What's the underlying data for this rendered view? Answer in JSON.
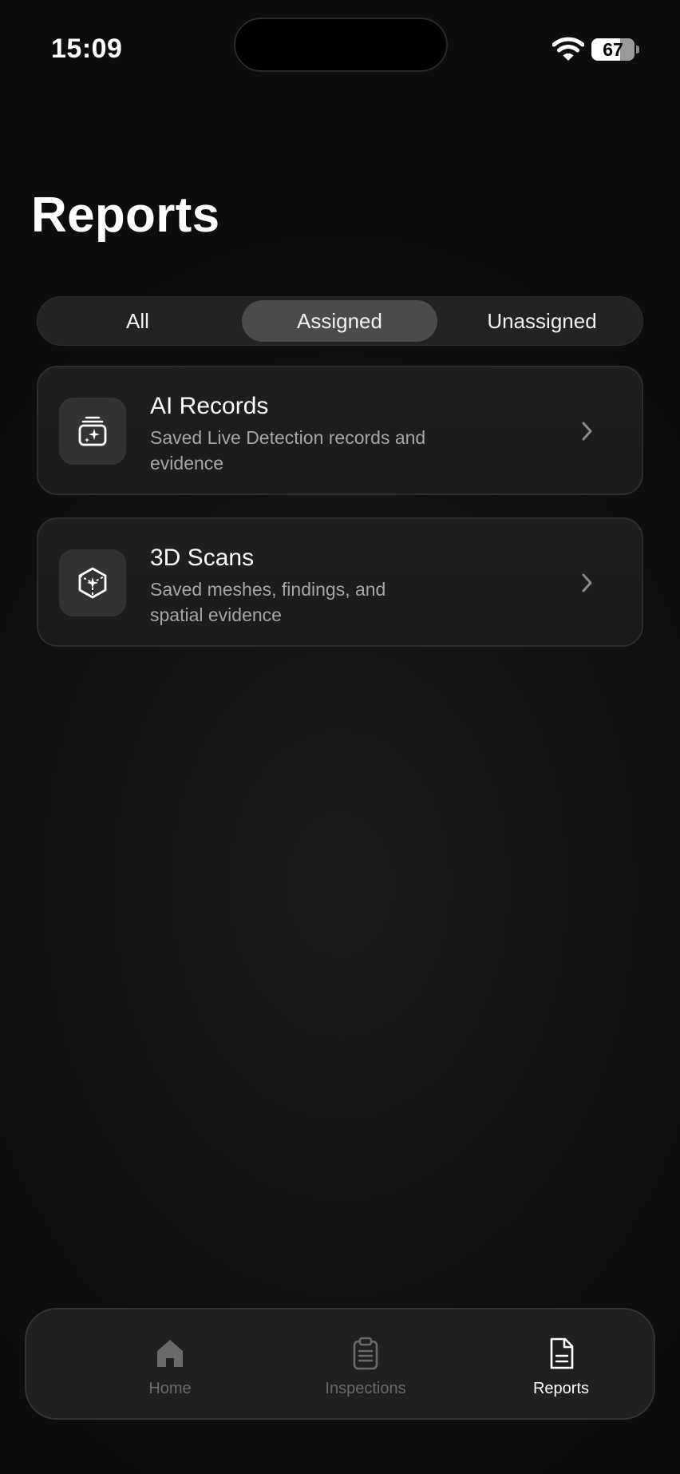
{
  "status_bar": {
    "time": "15:09",
    "battery_percent": "67",
    "battery_level": 0.67
  },
  "page": {
    "title": "Reports"
  },
  "segmented_control": {
    "selected": "Assigned",
    "segments": [
      {
        "label": "All"
      },
      {
        "label": "Assigned"
      },
      {
        "label": "Unassigned"
      }
    ]
  },
  "cards": [
    {
      "icon": "sparkle-stack-icon",
      "title": "AI Records",
      "description": "Saved Live Detection records and evidence"
    },
    {
      "icon": "cube-icon",
      "title": "3D Scans",
      "description": "Saved meshes, findings, and spatial evidence"
    }
  ],
  "tab_bar": {
    "selected": "Reports",
    "tabs": [
      {
        "label": "Home",
        "icon": "house-icon"
      },
      {
        "label": "Inspections",
        "icon": "clipboard-icon"
      },
      {
        "label": "Reports",
        "icon": "document-icon"
      }
    ]
  },
  "colors": {
    "background": "#0e0e0e",
    "card": "#1d1d1d",
    "segment_active": "#4b4b4b",
    "text_primary": "#ffffff",
    "text_secondary": "#a6a6a6",
    "tab_inactive": "#6a6a6a"
  }
}
